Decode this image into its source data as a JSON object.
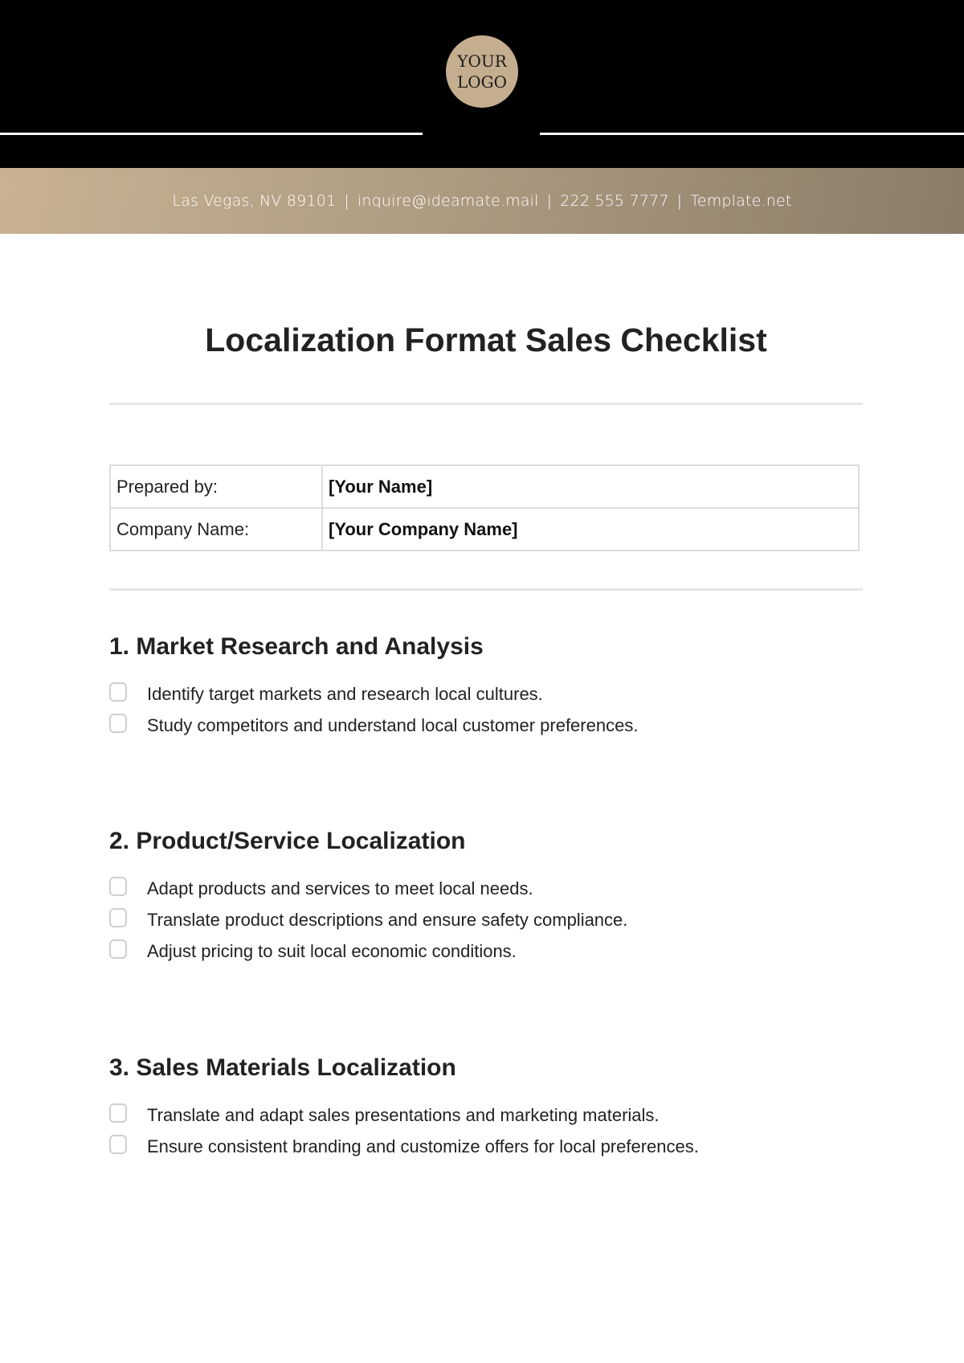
{
  "header": {
    "logo_line1": "YOUR",
    "logo_line2": "LOGO",
    "contact": {
      "address": "Las Vegas, NV 89101",
      "email": "inquire@ideamate.mail",
      "phone": "222 555 7777",
      "website": "Template.net",
      "separator": "|"
    }
  },
  "document": {
    "title": "Localization Format Sales Checklist",
    "info": [
      {
        "label": "Prepared by:",
        "value": "[Your Name]"
      },
      {
        "label": "Company Name:",
        "value": "[Your Company Name]"
      }
    ],
    "sections": [
      {
        "heading": "1. Market Research and Analysis",
        "items": [
          {
            "text": "Identify target markets and research local cultures.",
            "checked": false
          },
          {
            "text": "Study competitors and understand local customer preferences.",
            "checked": false
          }
        ]
      },
      {
        "heading": "2. Product/Service Localization",
        "items": [
          {
            "text": "Adapt products and services to meet local needs.",
            "checked": false
          },
          {
            "text": "Translate product descriptions and ensure safety compliance.",
            "checked": false
          },
          {
            "text": "Adjust pricing to suit local economic conditions.",
            "checked": false
          }
        ]
      },
      {
        "heading": "3. Sales Materials Localization",
        "items": [
          {
            "text": "Translate and adapt sales presentations and marketing materials.",
            "checked": false
          },
          {
            "text": "Ensure consistent branding and customize offers for local preferences.",
            "checked": false
          }
        ]
      }
    ]
  },
  "colors": {
    "header_background": "#000000",
    "logo_background": "#c5ae8f",
    "contact_gradient_start": "#c9b293",
    "contact_gradient_end": "#8a7c68"
  }
}
